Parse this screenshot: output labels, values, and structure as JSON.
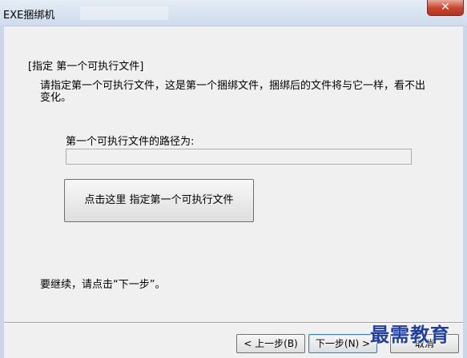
{
  "window": {
    "title": "EXE捆绑机",
    "close_glyph": "✕"
  },
  "step": {
    "title": "[指定 第一个可执行文件]",
    "description": "请指定第一个可执行文件，这是第一个捆绑文件，捆绑后的文件将与它一样，看不出变化。",
    "path_label": "第一个可执行文件的路径为:",
    "path_value": "",
    "choose_button": "点击这里 指定第一个可执行文件",
    "continue_hint": "要继续，请点击“下一步”。"
  },
  "footer": {
    "back_label": "< 上一步(B)",
    "next_label": "下一步(N) >",
    "cancel_label": "取消"
  },
  "watermark": {
    "text": "最需教育"
  },
  "colors": {
    "titlebar": "#cfdcec",
    "close": "#c7432b",
    "watermark": "#1f3fa8"
  }
}
